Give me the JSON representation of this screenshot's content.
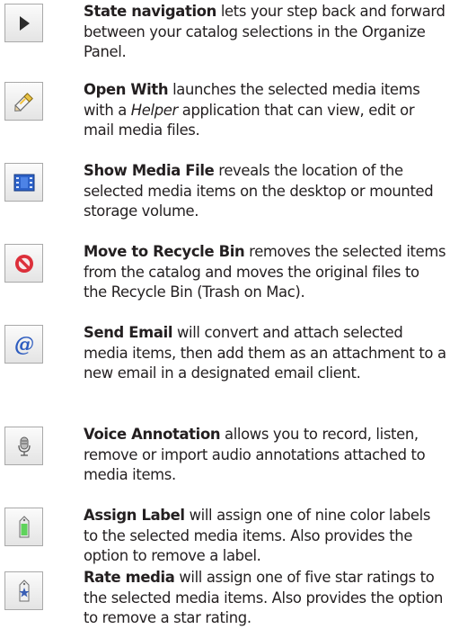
{
  "items": [
    {
      "icon": "play-arrow-icon",
      "title": "State navigation",
      "text": " lets your step back and forward between your catalog selections in the Organize Panel."
    },
    {
      "icon": "pencil-icon",
      "title": "Open With",
      "text_before": " launches the selected media items with a ",
      "emphasis": "Helper",
      "text_after": " application that can view, edit or mail media files."
    },
    {
      "icon": "media-file-icon",
      "title": "Show Media File",
      "text": " reveals the location of the selected media items on the desktop or mounted storage volume."
    },
    {
      "icon": "prohibited-icon",
      "title": "Move to Recycle Bin",
      "text": " removes the selected items from the catalog and moves the original files to the Recycle Bin (Trash on Mac)."
    },
    {
      "icon": "at-sign-icon",
      "title": "Send Email",
      "text": " will convert and attach selected media items, then add them as an attachment to a new email in a designated email client."
    },
    {
      "icon": "microphone-icon",
      "title": "Voice Annotation",
      "text": " allows you to record, listen, remove or import audio annotations attached to media items."
    },
    {
      "icon": "color-label-icon",
      "title": "Assign Label",
      "text": " will assign one of nine color labels to the selected media items. Also provides the option to remove a label."
    },
    {
      "icon": "star-rating-icon",
      "title": "Rate media",
      "text": " will assign one of five star ratings to the selected media items. Also provides the option to remove a star rating."
    }
  ]
}
